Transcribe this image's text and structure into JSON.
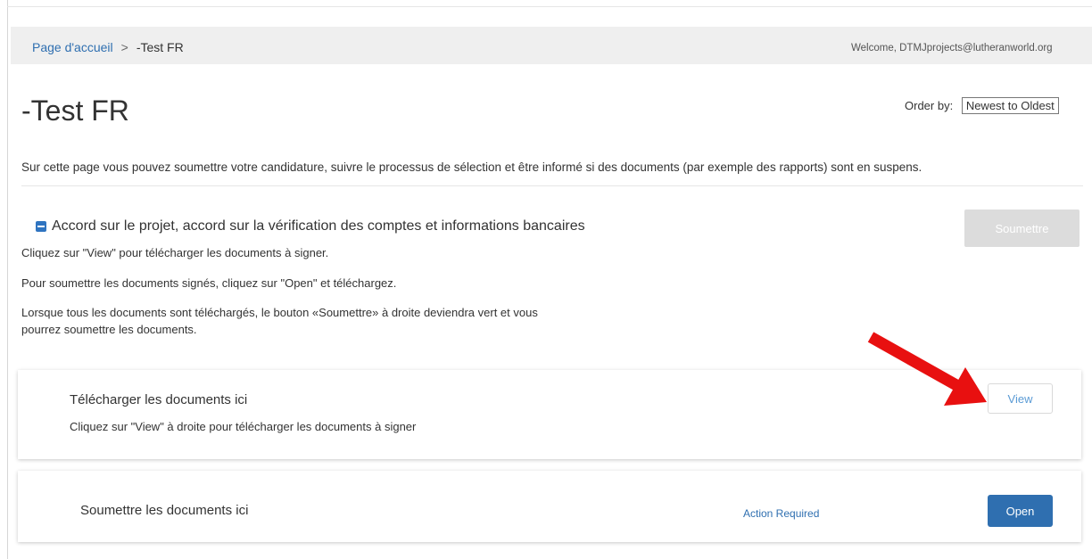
{
  "header": {
    "breadcrumb_home": "Page d'accueil",
    "breadcrumb_separator": ">",
    "breadcrumb_current": "-Test FR",
    "welcome": "Welcome, DTMJprojects@lutheranworld.org"
  },
  "page": {
    "title": "-Test FR",
    "order_by_label": "Order by:",
    "order_by_value": "Newest to Oldest",
    "intro": "Sur cette page vous pouvez soumettre votre candidature, suivre le processus de sélection et être informé si des documents (par exemple des rapports) sont en suspens."
  },
  "section": {
    "title": "Accord sur le projet, accord sur la vérification des comptes et informations bancaires",
    "line1": "Cliquez sur \"View\" pour télécharger les documents à signer.",
    "line2": "Pour soumettre les documents signés, cliquez sur \"Open\" et téléchargez.",
    "line3a": "Lorsque tous les documents sont téléchargés, le bouton «Soumettre» à droite deviendra vert et vous",
    "line3b": "pourrez soumettre les documents.",
    "submit_label": "Soumettre"
  },
  "cards": [
    {
      "title": "Télécharger les documents ici",
      "subtitle": "Cliquez sur \"View\" à droite pour télécharger les documents à signer",
      "button": "View"
    },
    {
      "title": "Soumettre les documents ici",
      "status": "Action Required",
      "button": "Open"
    }
  ],
  "colors": {
    "link": "#2f6fb0",
    "primary_button": "#2f6fb0",
    "disabled_button": "#dcdcdc",
    "annotation_arrow": "#e81010"
  },
  "icons": {
    "section_toggle": "collapse-minus-icon",
    "annotation": "red-arrow-icon"
  }
}
